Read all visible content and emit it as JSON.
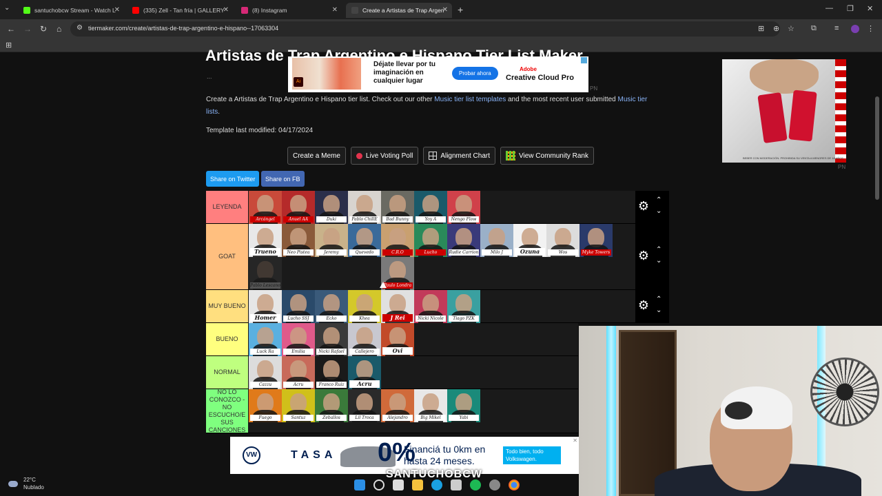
{
  "browser": {
    "tabs": [
      {
        "title": "santuchobcw Stream - Watch L",
        "fav": "#53fc18",
        "active": false
      },
      {
        "title": "(335) Zell - Tan fría | GALLERY S",
        "fav": "#ff0000",
        "active": false
      },
      {
        "title": "(8) Instagram",
        "fav": "#d62976",
        "active": false
      },
      {
        "title": "Create a Artistas de Trap Argen",
        "fav": "#444444",
        "active": true
      }
    ],
    "url": "tiermaker.com/create/artistas-de-trap-argentino-e-hispano--17063304"
  },
  "page": {
    "title": "Artistas de Trap Argentino e Hispano Tier List Maker",
    "dots": "...",
    "desc_prefix": "Create a Artistas de Trap Argentino e Hispano tier list. Check out our other ",
    "desc_link1": "Music tier list templates",
    "desc_middle": " and the most recent user submitted ",
    "desc_link2": "Music tier lists",
    "desc_suffix": ".",
    "modified": "Template last modified: 04/17/2024",
    "buttons": {
      "meme": "Create a Meme",
      "poll": "Live Voting Poll",
      "alignment": "Alignment Chart",
      "community": "View Community Rank"
    },
    "share_twitter": "Share on Twitter",
    "share_fb": "Share on FB"
  },
  "ads": {
    "top_headline": "Déjate llevar por tu imaginación en cualquier lugar",
    "top_cta": "Probar ahora",
    "top_brand1": "Adobe",
    "top_brand2": "Creative Cloud Pro",
    "pn": "PN",
    "right_legal": "BEBER CON MODERACIÓN. PROHIBIDA SU VENTA A MENORES DE 18 AÑOS",
    "bottom_tasa": "TASA",
    "bottom_pct": "0%",
    "bottom_text": "Financiá tu 0km en hasta 24 meses.",
    "bottom_tag": "Todo bien, todo Volkswagen.",
    "bottom_vw": "VW"
  },
  "tiers": [
    {
      "label": "LEYENDA",
      "color": "#ff7f7f",
      "items": [
        {
          "name": "Arcángel",
          "bg": "#c94a3a",
          "red": true
        },
        {
          "name": "Anuel AA",
          "bg": "#b52a2a",
          "red": true
        },
        {
          "name": "Duki",
          "bg": "#2b2f4a"
        },
        {
          "name": "Pablo ChillE",
          "bg": "#d8d4cf"
        },
        {
          "name": "Bad Bunny",
          "bg": "#6a6a62"
        },
        {
          "name": "Yoy A",
          "bg": "#1a5a6a"
        },
        {
          "name": "Ñengo Flow",
          "bg": "#d0414a"
        }
      ]
    },
    {
      "label": "GOAT",
      "color": "#ffbf7f",
      "items": [
        {
          "name": "Trueno",
          "bg": "#e8e8e8",
          "big": true
        },
        {
          "name": "Neo Pistea",
          "bg": "#8a5a3a"
        },
        {
          "name": "Jeremy",
          "bg": "#c9b28a"
        },
        {
          "name": "Quevedo",
          "bg": "#3a6a9a"
        },
        {
          "name": "C.R.O",
          "bg": "#c9a070",
          "red": true
        },
        {
          "name": "Lucho",
          "bg": "#2a8a5a",
          "red": true
        },
        {
          "name": "Rudie Carrion",
          "bg": "#3a3a7a"
        },
        {
          "name": "Milo J",
          "bg": "#9ab0c8"
        },
        {
          "name": "Ozuna",
          "bg": "#f2f2f2",
          "big": true
        },
        {
          "name": "Wos",
          "bg": "#dcdcdc"
        },
        {
          "name": "Myke Towers",
          "bg": "#2a3a6a",
          "red": true
        },
        {
          "name": "Pablo Lescano",
          "bg": "#4a4a4a",
          "dim": true
        },
        {
          "name": "",
          "bg": "#1a1a1a",
          "empty": true
        },
        {
          "name": "",
          "bg": "#1a1a1a",
          "empty": true
        },
        {
          "name": "",
          "bg": "#1a1a1a",
          "empty": true
        },
        {
          "name": "Paulo Londra",
          "bg": "#7a7a7a",
          "red": true
        }
      ]
    },
    {
      "label": "MUY BUENO",
      "color": "#ffdf7f",
      "items": [
        {
          "name": "Homer",
          "bg": "#e6e6e6",
          "big": true
        },
        {
          "name": "Lucho SSJ",
          "bg": "#2a4a6a"
        },
        {
          "name": "Ecko",
          "bg": "#3a5a7a"
        },
        {
          "name": "Khea",
          "bg": "#d4c82a"
        },
        {
          "name": "J Rei",
          "bg": "#e0e0e0",
          "red": true,
          "big": true
        },
        {
          "name": "Nicki Nicole",
          "bg": "#c23a5a"
        },
        {
          "name": "Tiago PZK",
          "bg": "#3aa0a0"
        }
      ]
    },
    {
      "label": "BUENO",
      "color": "#ffff7f",
      "items": [
        {
          "name": "Luck Ra",
          "bg": "#5ab0e0"
        },
        {
          "name": "Emilia",
          "bg": "#e05a8a"
        },
        {
          "name": "Nicki Rafael",
          "bg": "#3a3a3a"
        },
        {
          "name": "Callejero",
          "bg": "#c8c8d0"
        },
        {
          "name": "Ovi",
          "bg": "#c24a2a",
          "big": true
        }
      ]
    },
    {
      "label": "NORMAL",
      "color": "#bfff7f",
      "items": [
        {
          "name": "Cazzu",
          "bg": "#dcdcdc"
        },
        {
          "name": "Acru",
          "bg": "#c86a5a"
        },
        {
          "name": "Franco Ruiz",
          "bg": "#1a1a1a"
        },
        {
          "name": "Acru",
          "bg": "#1a5a6a",
          "big": true
        }
      ]
    },
    {
      "label": "NO LO CONOZCO - NO ESCUCHO/E SUS CANCIONES",
      "color": "#7fff7f",
      "items": [
        {
          "name": "Fuego",
          "bg": "#e07a1a"
        },
        {
          "name": "Santuz",
          "bg": "#d0c01a"
        },
        {
          "name": "Zeballos",
          "bg": "#3a7a3a"
        },
        {
          "name": "Lil Troca",
          "bg": "#2a2a2a"
        },
        {
          "name": "Alejandro",
          "bg": "#d06a3a"
        },
        {
          "name": "Big Mikel",
          "bg": "#e8e8e8"
        },
        {
          "name": "Yabi",
          "bg": "#1a8a7a"
        }
      ]
    }
  ],
  "stream": {
    "watermark": "SANTUCHOBCW"
  },
  "taskbar": {
    "temp": "22°C",
    "condition": "Nublado"
  }
}
